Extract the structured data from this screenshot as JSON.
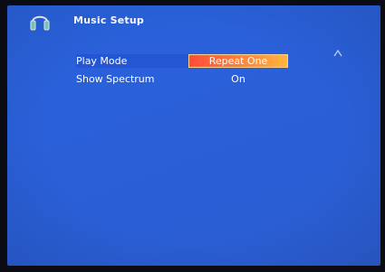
{
  "header": {
    "title": "Music Setup",
    "icon": "headphones-icon"
  },
  "menu": {
    "items": [
      {
        "label": "Play Mode",
        "value": "Repeat One",
        "selected": true
      },
      {
        "label": "Show Spectrum",
        "value": "On",
        "selected": false
      }
    ]
  },
  "colors": {
    "background": "#2a5fd8",
    "highlight_gradient_start": "#ff4c3b",
    "highlight_gradient_end": "#ffb63e",
    "text": "#ffffff"
  }
}
